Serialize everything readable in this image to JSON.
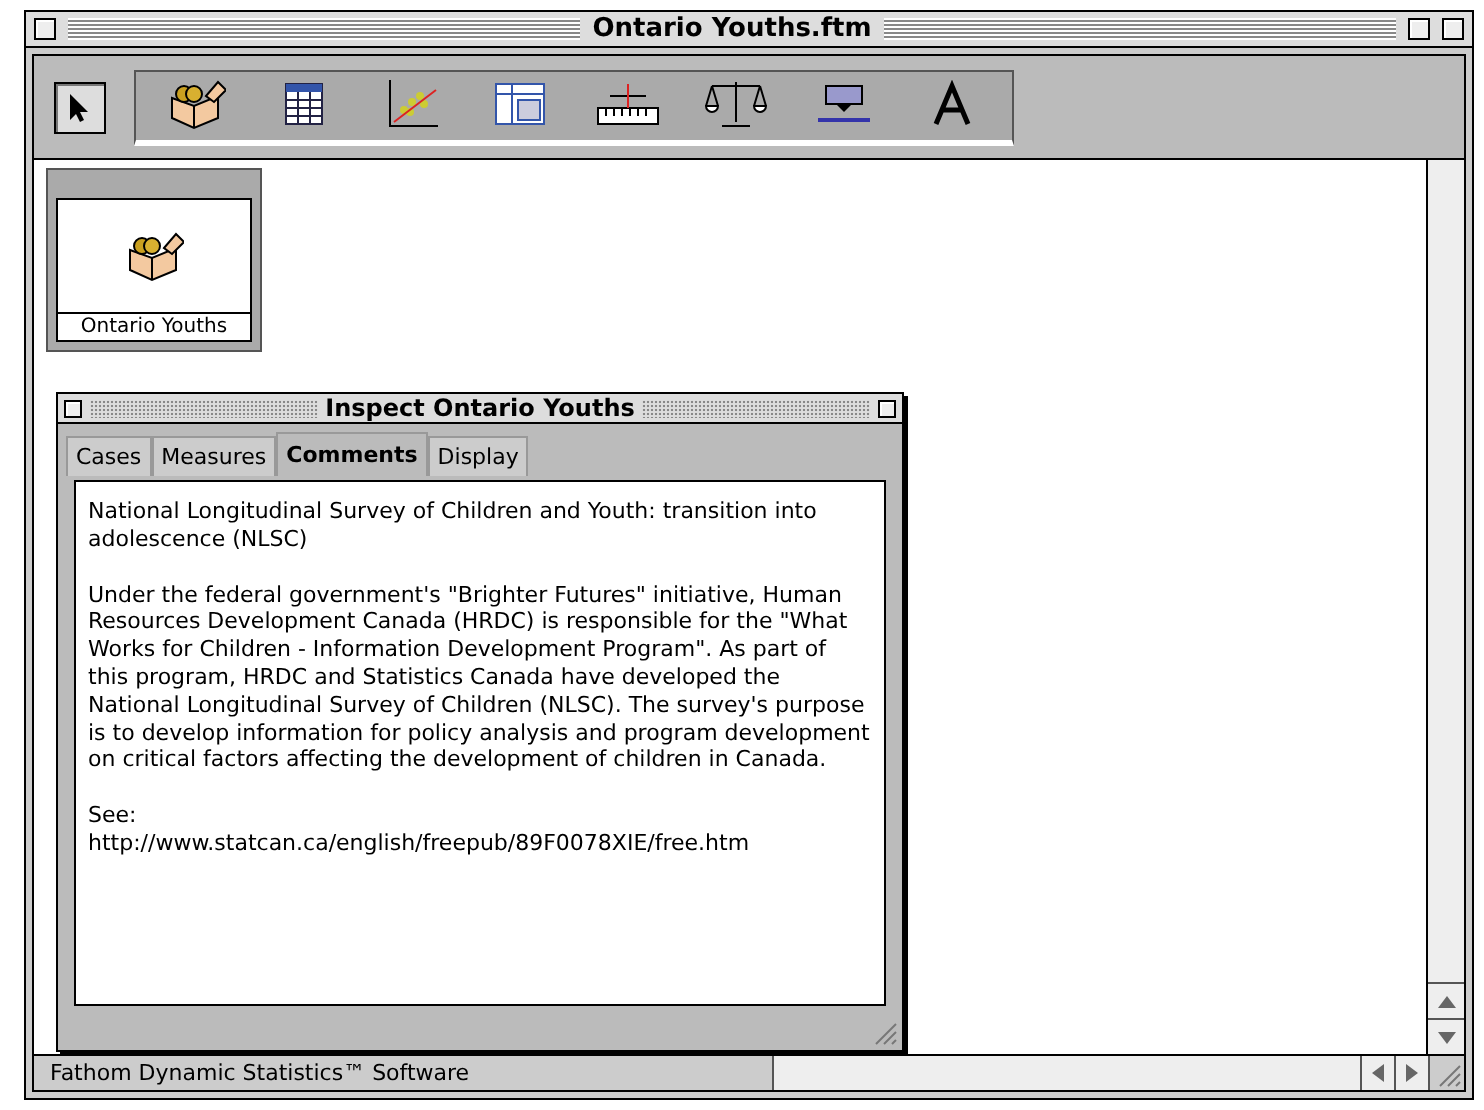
{
  "window": {
    "title": "Ontario Youths.ftm"
  },
  "toolbar": {
    "tools": [
      {
        "kind": "pointer",
        "selected": true
      },
      {
        "kind": "collection",
        "selected": false
      },
      {
        "kind": "table",
        "selected": false
      },
      {
        "kind": "graph",
        "selected": false
      },
      {
        "kind": "summary",
        "selected": false
      },
      {
        "kind": "estimate",
        "selected": false
      },
      {
        "kind": "test",
        "selected": false
      },
      {
        "kind": "slider",
        "selected": false
      },
      {
        "kind": "text",
        "selected": false
      }
    ]
  },
  "collection": {
    "name": "Ontario Youths"
  },
  "inspector": {
    "title": "Inspect Ontario Youths",
    "tabs": [
      {
        "label": "Cases",
        "selected": false
      },
      {
        "label": "Measures",
        "selected": false
      },
      {
        "label": "Comments",
        "selected": true
      },
      {
        "label": "Display",
        "selected": false
      }
    ],
    "comments": [
      "National Longitudinal Survey of Children and Youth: transition into adolescence (NLSC)",
      "Under the federal government's \"Brighter Futures\" initiative, Human Resources Development Canada (HRDC) is responsible for the \"What Works for Children - Information Development Program\". As part of this program, HRDC and Statistics Canada have developed the National Longitudinal Survey of Children (NLSC). The survey's purpose is to develop information for policy analysis and program development on critical factors affecting the development of children in Canada.",
      "See:\nhttp://www.statcan.ca/english/freepub/89F0078XIE/free.htm"
    ]
  },
  "status_bar": {
    "text": "Fathom Dynamic Statistics™ Software"
  }
}
